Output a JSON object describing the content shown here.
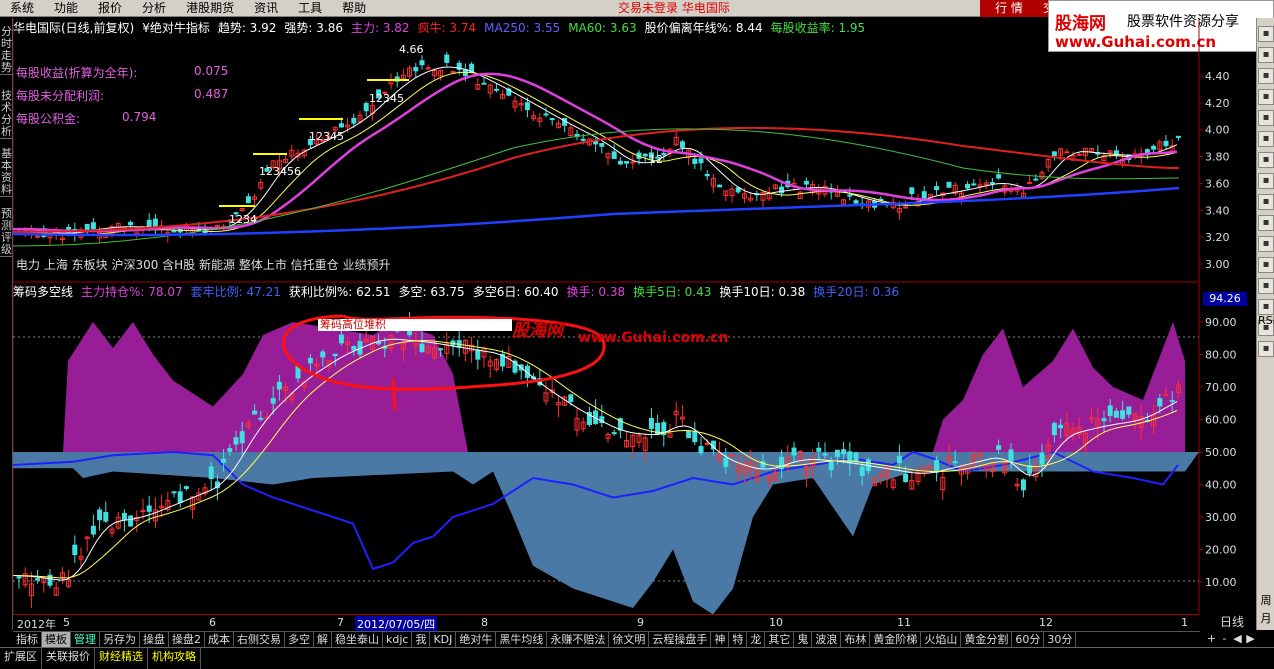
{
  "menu": [
    "系统",
    "功能",
    "报价",
    "分析",
    "港股期货",
    "资讯",
    "工具",
    "帮助"
  ],
  "status_message": "交易未登录  华电国际",
  "quote_button": "行 情",
  "trade_button": "交",
  "logo": {
    "site_cn": "股海网",
    "slogan": "股票软件资源分享",
    "url": "www.Guhai.com.cn"
  },
  "left_tabs": [
    "分时走势",
    "技术分析",
    "基本资料",
    "预测评级"
  ],
  "main_header": {
    "title": "华电国际(日线,前复权)",
    "indicator": "¥绝对牛指标",
    "items": [
      {
        "text": "趋势: 3.92",
        "color": "#ffffff"
      },
      {
        "text": "强势: 3.86",
        "color": "#ffffff"
      },
      {
        "text": "主力: 3.82",
        "color": "#e040e0"
      },
      {
        "text": "疯牛: 3.74",
        "color": "#ff2020"
      },
      {
        "text": "MA250: 3.55",
        "color": "#6060ff"
      },
      {
        "text": "MA60: 3.63",
        "color": "#40e040"
      },
      {
        "text": "股价偏离年线%: 8.44",
        "color": "#ffffff"
      },
      {
        "text": "每股收益率: 1.95",
        "color": "#40e040"
      }
    ]
  },
  "fundamentals": [
    {
      "label": "每股收益(折算为全年):",
      "value": "0.075"
    },
    {
      "label": "每股未分配利润:",
      "value": "0.487"
    },
    {
      "label": "每股公积金:",
      "value": "0.794"
    }
  ],
  "concept_tags": "电力 上海 东板块 沪深300 含H股 新能源 整体上市 信托重仓 业绩预升",
  "price_axis": [
    "4.40",
    "4.20",
    "4.00",
    "3.80",
    "3.60",
    "3.40",
    "3.20",
    "3.00"
  ],
  "price_labels": [
    "4.66",
    "12345",
    "12345",
    "123456",
    "1234",
    "12"
  ],
  "indicator_header": {
    "title": "筹码多空线",
    "items": [
      {
        "text": "主力持仓%: 78.07",
        "color": "#e040e0"
      },
      {
        "text": "套牢比例: 47.21",
        "color": "#4060ff"
      },
      {
        "text": "获利比例%: 62.51",
        "color": "#ffffff"
      },
      {
        "text": "多空: 63.75",
        "color": "#ffffff"
      },
      {
        "text": "多空6日: 60.40",
        "color": "#ffffff"
      },
      {
        "text": "换手: 0.38",
        "color": "#e040e0"
      },
      {
        "text": "换手5日: 0.43",
        "color": "#40e040"
      },
      {
        "text": "换手10日: 0.38",
        "color": "#ffffff"
      },
      {
        "text": "换手20日: 0.36",
        "color": "#4060ff"
      }
    ]
  },
  "indicator_axis": [
    "90.00",
    "80.00",
    "70.00",
    "60.00",
    "50.00",
    "40.00",
    "30.00",
    "20.00",
    "10.00"
  ],
  "indicator_badge": "94.26",
  "annotation": "筹码高位堆积",
  "watermark": {
    "brand": "股海网",
    "url": "www.Guhai.com.cn"
  },
  "time_axis": [
    "2012年",
    "5",
    "6",
    "7",
    "2012/07/05/四",
    "8",
    "9",
    "10",
    "11",
    "12",
    "1"
  ],
  "period": "日线",
  "right_tools": [
    "RSI",
    "周",
    "月"
  ],
  "formula_tabs": [
    "指标",
    "模板",
    "管理",
    "另存为",
    "操盘",
    "操盘2",
    "成本",
    "右侧交易",
    "多空",
    "解",
    "稳坐泰山",
    "kdjc",
    "我",
    "KDJ",
    "绝对牛",
    "黑牛均线",
    "永赚不赔法",
    "徐文明",
    "云程操盘手",
    "神",
    "特",
    "龙",
    "其它",
    "鬼",
    "波浪",
    "布林",
    "黄金阶梯",
    "火焰山",
    "黄金分割",
    "60分",
    "30分"
  ],
  "nav_buttons": [
    "+",
    "-",
    "◀",
    "▶"
  ],
  "bottom_tabs": [
    "扩展区",
    "关联报价",
    "财经精选",
    "机构攻略"
  ]
}
